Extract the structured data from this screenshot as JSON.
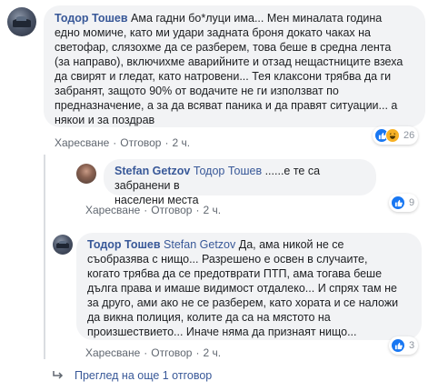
{
  "comments": [
    {
      "author": "Тодор Тошев",
      "mention": "",
      "lines": [
        "Ама гадни бо*луци има... Мен миналата година",
        "едно момиче, като ми удари задната броня докато чаках на",
        "светофар, слязохме да се разберем, това беше в средна лента",
        "(за направо), включихме аварийните и отзад нещастниците взеха",
        "да свирят и гледат, като натровени... Тея клаксони трябва да ги",
        "забранят, защото 90% от водачите не ги използват по",
        "предназначение, а за да всяват паника и да правят ситуации... а",
        "някои и за поздрав"
      ],
      "like": "Харесване",
      "reply": "Отговор",
      "time": "2 ч.",
      "reaction_count": "26"
    },
    {
      "author": "Stefan Getzov",
      "mention": "Тодор Тошев",
      "lines": [
        "......е те са забранени в",
        "населени места"
      ],
      "like": "Харесване",
      "reply": "Отговор",
      "time": "2 ч.",
      "reaction_count": "9"
    },
    {
      "author": "Тодор Тошев",
      "mention": "Stefan Getzov",
      "lines": [
        "Да, ама никой не се",
        "съобразява с нищо... Разрешено е освен в случаите,",
        "когато трябва да се предотврати ПТП, ама тогава беше",
        "дълга права и имаше видимост отдалеко... И спрях там не",
        "за друго, ами ако не се разберем, като хората и се наложи",
        "да викна полиция, колите да са на мястото на",
        "произшествието... Иначе няма да признаят нищо..."
      ],
      "like": "Харесване",
      "reply": "Отговор",
      "time": "2 ч.",
      "reaction_count": "3"
    }
  ],
  "sep": "·",
  "more_replies": "Преглед на още 1 отговор",
  "colors": {
    "link": "#385898",
    "bubble": "#f2f3f5",
    "meta": "#606770",
    "like_blue": "#1877f2",
    "haha_yellow": "#f7b125"
  },
  "icons": [
    "thumbs-up-icon",
    "haha-icon",
    "reply-arrow-icon"
  ]
}
